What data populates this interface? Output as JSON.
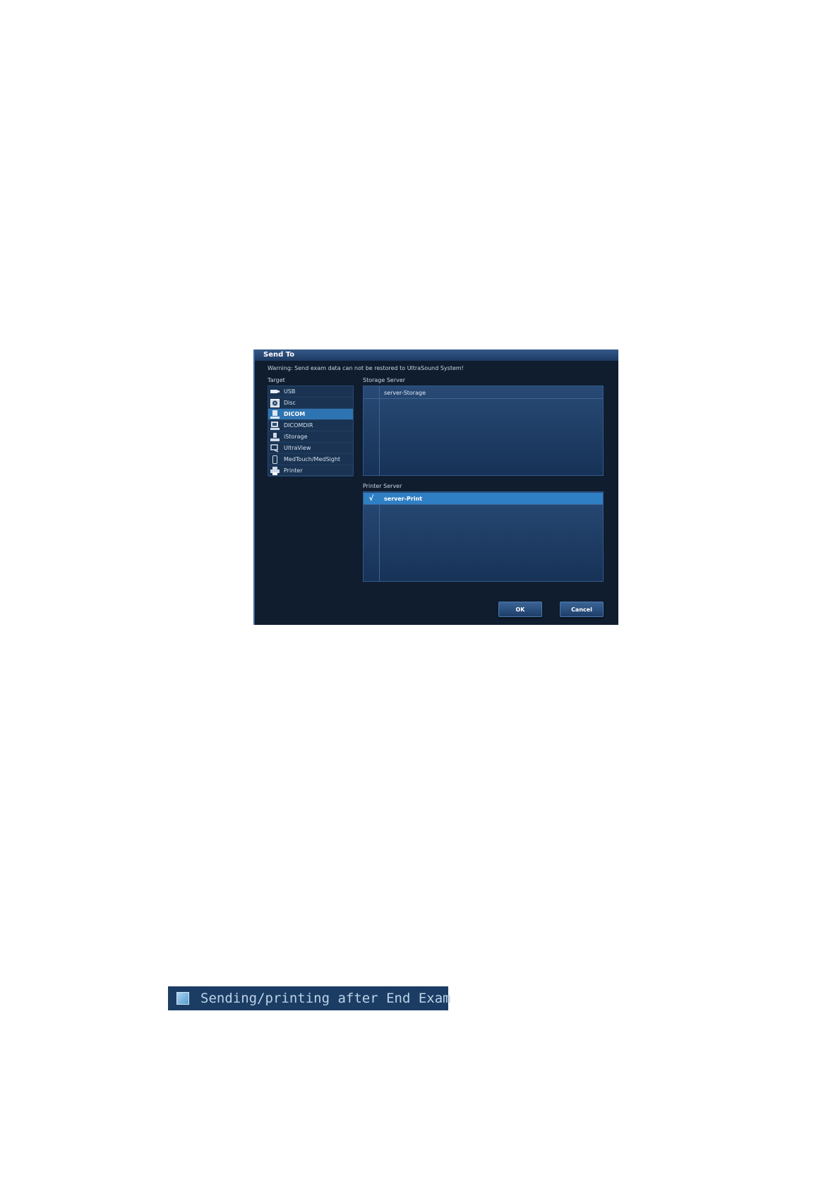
{
  "dialog": {
    "title": "Send To",
    "warning": "Warning: Send exam data can not be restored to UltraSound System!",
    "target_label": "Target",
    "targets": [
      {
        "label": "USB",
        "icon": "usb-icon"
      },
      {
        "label": "Disc",
        "icon": "disc-icon"
      },
      {
        "label": "DICOM",
        "icon": "dicom-icon",
        "selected": true
      },
      {
        "label": "DICOMDIR",
        "icon": "dicomdir-icon"
      },
      {
        "label": "iStorage",
        "icon": "istorage-icon"
      },
      {
        "label": "UltraView",
        "icon": "ultraview-icon"
      },
      {
        "label": "MedTouch/MedSight",
        "icon": "mobile-icon"
      },
      {
        "label": "Printer",
        "icon": "printer-icon"
      }
    ],
    "storage_server_label": "Storage Server",
    "storage_servers": [
      {
        "check": "",
        "name": "server-Storage",
        "selected": false
      }
    ],
    "printer_server_label": "Printer Server",
    "printer_servers": [
      {
        "check": "√",
        "name": "server-Print",
        "selected": true
      }
    ],
    "ok_label": "OK",
    "cancel_label": "Cancel"
  },
  "option": {
    "label": "Sending/printing after End Exam",
    "checked": false
  },
  "colors": {
    "dialog_bg": "#0f1d2f",
    "selected": "#2f74b2",
    "panel": "#1c3d63"
  }
}
